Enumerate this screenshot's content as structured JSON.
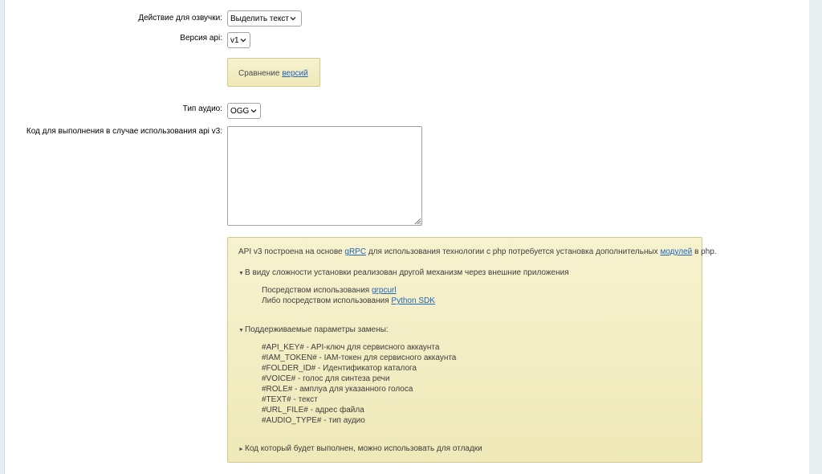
{
  "form": {
    "voice_action_label": "Действие для озвучки:",
    "voice_action_value": "Выделить текст",
    "api_version_label": "Версия api:",
    "api_version_value": "v1",
    "compare_text": "Сравнение",
    "compare_link": "версий",
    "audio_type_label": "Тип аудио:",
    "audio_type_value": "OGG",
    "code_label": "Код для выполнения в случае использования api v3:",
    "code_value": ""
  },
  "info": {
    "intro_pre": "API v3 построена на основе",
    "intro_link1": "gRPC",
    "intro_mid": "для использования технологии с php потребуется установка дополнительных",
    "intro_link2": "модулей",
    "intro_post": "в php.",
    "section1_title": "В виду сложности установки реализован другой механизм через внешние приложения",
    "section1_line1_pre": "Посредством использования",
    "section1_line1_link": "grpcurl",
    "section1_line2_pre": "Либо посредством использования",
    "section1_line2_link": "Python SDK",
    "section2_title": "Поддерживаемые параметры замены:",
    "params": [
      "#API_KEY# - API-ключ для сервисного аккаунта",
      "#IAM_TOKEN# - IAM-токен для сервисного аккаунта",
      "#FOLDER_ID# - Идентификатор каталога",
      "#VOICE# - голос для синтеза речи",
      "#ROLE# - амплуа для указанного голоса",
      "#TEXT# - текст",
      "#URL_FILE# - адрес файла",
      "#AUDIO_TYPE# - тип аудио"
    ],
    "section3_title": "Код который будет выполнен, можно использовать для отладки"
  }
}
